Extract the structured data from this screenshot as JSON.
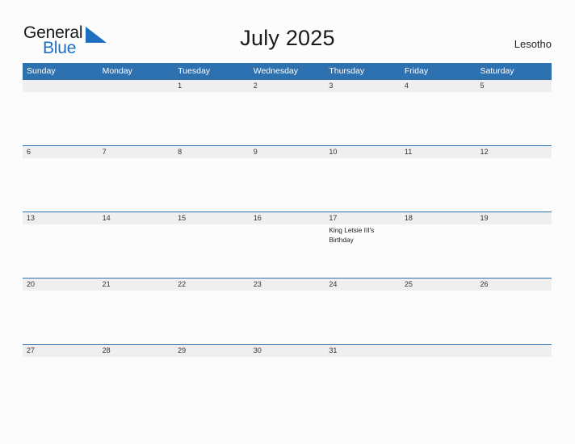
{
  "brand": {
    "name_part1": "General",
    "name_part2": "Blue",
    "logo_icon": "blue-triangle-flag-icon",
    "accent_color": "#1f6fc0"
  },
  "header": {
    "title": "July 2025",
    "country": "Lesotho"
  },
  "theme": {
    "header_blue": "#2e71b0",
    "row_band_gray": "#efefef",
    "page_background": "#fcfcfc",
    "text_color": "#333333"
  },
  "calendar": {
    "month": "July",
    "year": "2025",
    "weekday_headers": [
      "Sunday",
      "Monday",
      "Tuesday",
      "Wednesday",
      "Thursday",
      "Friday",
      "Saturday"
    ],
    "weeks": [
      {
        "days": [
          {
            "num": "",
            "events": []
          },
          {
            "num": "",
            "events": []
          },
          {
            "num": "1",
            "events": []
          },
          {
            "num": "2",
            "events": []
          },
          {
            "num": "3",
            "events": []
          },
          {
            "num": "4",
            "events": []
          },
          {
            "num": "5",
            "events": []
          }
        ]
      },
      {
        "days": [
          {
            "num": "6",
            "events": []
          },
          {
            "num": "7",
            "events": []
          },
          {
            "num": "8",
            "events": []
          },
          {
            "num": "9",
            "events": []
          },
          {
            "num": "10",
            "events": []
          },
          {
            "num": "11",
            "events": []
          },
          {
            "num": "12",
            "events": []
          }
        ]
      },
      {
        "days": [
          {
            "num": "13",
            "events": []
          },
          {
            "num": "14",
            "events": []
          },
          {
            "num": "15",
            "events": []
          },
          {
            "num": "16",
            "events": []
          },
          {
            "num": "17",
            "events": [
              "King Letsie III's Birthday"
            ]
          },
          {
            "num": "18",
            "events": []
          },
          {
            "num": "19",
            "events": []
          }
        ]
      },
      {
        "days": [
          {
            "num": "20",
            "events": []
          },
          {
            "num": "21",
            "events": []
          },
          {
            "num": "22",
            "events": []
          },
          {
            "num": "23",
            "events": []
          },
          {
            "num": "24",
            "events": []
          },
          {
            "num": "25",
            "events": []
          },
          {
            "num": "26",
            "events": []
          }
        ]
      },
      {
        "days": [
          {
            "num": "27",
            "events": []
          },
          {
            "num": "28",
            "events": []
          },
          {
            "num": "29",
            "events": []
          },
          {
            "num": "30",
            "events": []
          },
          {
            "num": "31",
            "events": []
          },
          {
            "num": "",
            "events": []
          },
          {
            "num": "",
            "events": []
          }
        ]
      }
    ]
  }
}
